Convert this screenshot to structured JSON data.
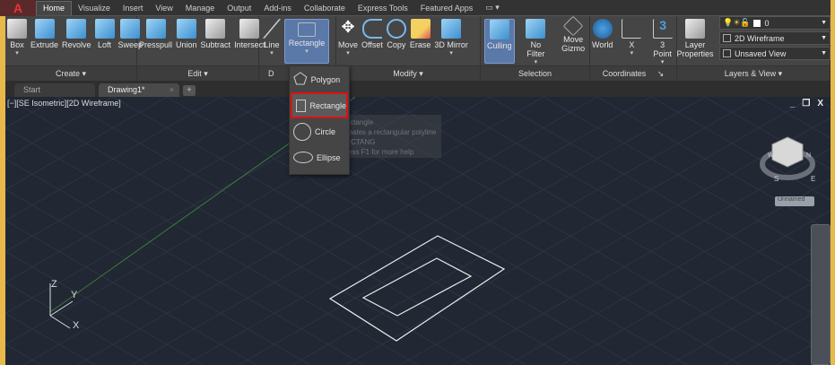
{
  "app": {
    "logo": "A"
  },
  "ribbon_tabs": [
    "Home",
    "Visualize",
    "Insert",
    "View",
    "Manage",
    "Output",
    "Add-ins",
    "Collaborate",
    "Express Tools",
    "Featured Apps"
  ],
  "panels": [
    {
      "label": "Create",
      "buttons": [
        "Box",
        "Extrude",
        "Revolve",
        "Loft",
        "Sweep"
      ]
    },
    {
      "label": "Edit",
      "buttons": [
        "Presspull",
        "Union",
        "Subtract",
        "Intersect"
      ]
    },
    {
      "label": "D",
      "buttons": [
        "Line",
        "Rectangle"
      ]
    },
    {
      "label": "Modify",
      "buttons": [
        "Move",
        "Offset",
        "Copy",
        "Erase",
        "3D Mirror"
      ]
    },
    {
      "label": "Selection",
      "buttons": [
        "Culling",
        "No Filter",
        "Move Gizmo"
      ]
    },
    {
      "label": "Coordinates",
      "buttons": [
        "World",
        "X",
        "3 Point"
      ]
    },
    {
      "label": "Layers & View",
      "buttons": [
        "Layer Properties"
      ]
    }
  ],
  "layers": {
    "layer": "0",
    "visual_style": "2D Wireframe",
    "view": "Unsaved View"
  },
  "file_tabs": [
    {
      "label": "Start"
    },
    {
      "label": "Drawing1*"
    }
  ],
  "file_tab_add": "+",
  "viewport": {
    "label": "[−][SE Isometric][2D Wireframe]",
    "view_name": "Unnamed",
    "window_controls": [
      "_",
      "❐",
      "X"
    ],
    "compass": [
      "S",
      "E",
      "W",
      "N"
    ],
    "axes": [
      "Z",
      "Y",
      "X"
    ]
  },
  "draw_menu": [
    "Polygon",
    "Rectangle",
    "Circle",
    "Ellipse"
  ],
  "tooltip": {
    "title": "Rectangle",
    "desc": "Creates a rectangular polyline",
    "command": "RECTANG",
    "help": "Press F1 for more help"
  }
}
